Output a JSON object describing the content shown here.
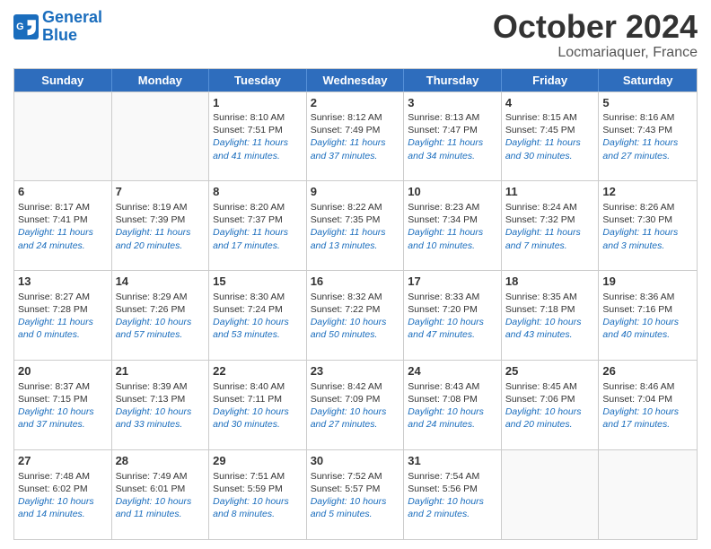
{
  "logo": {
    "text_general": "General",
    "text_blue": "Blue"
  },
  "title": "October 2024",
  "subtitle": "Locmariaquer, France",
  "weekdays": [
    "Sunday",
    "Monday",
    "Tuesday",
    "Wednesday",
    "Thursday",
    "Friday",
    "Saturday"
  ],
  "weeks": [
    [
      {
        "day": "",
        "sunrise": "",
        "sunset": "",
        "daylight": ""
      },
      {
        "day": "",
        "sunrise": "",
        "sunset": "",
        "daylight": ""
      },
      {
        "day": "1",
        "sunrise": "Sunrise: 8:10 AM",
        "sunset": "Sunset: 7:51 PM",
        "daylight": "Daylight: 11 hours and 41 minutes."
      },
      {
        "day": "2",
        "sunrise": "Sunrise: 8:12 AM",
        "sunset": "Sunset: 7:49 PM",
        "daylight": "Daylight: 11 hours and 37 minutes."
      },
      {
        "day": "3",
        "sunrise": "Sunrise: 8:13 AM",
        "sunset": "Sunset: 7:47 PM",
        "daylight": "Daylight: 11 hours and 34 minutes."
      },
      {
        "day": "4",
        "sunrise": "Sunrise: 8:15 AM",
        "sunset": "Sunset: 7:45 PM",
        "daylight": "Daylight: 11 hours and 30 minutes."
      },
      {
        "day": "5",
        "sunrise": "Sunrise: 8:16 AM",
        "sunset": "Sunset: 7:43 PM",
        "daylight": "Daylight: 11 hours and 27 minutes."
      }
    ],
    [
      {
        "day": "6",
        "sunrise": "Sunrise: 8:17 AM",
        "sunset": "Sunset: 7:41 PM",
        "daylight": "Daylight: 11 hours and 24 minutes."
      },
      {
        "day": "7",
        "sunrise": "Sunrise: 8:19 AM",
        "sunset": "Sunset: 7:39 PM",
        "daylight": "Daylight: 11 hours and 20 minutes."
      },
      {
        "day": "8",
        "sunrise": "Sunrise: 8:20 AM",
        "sunset": "Sunset: 7:37 PM",
        "daylight": "Daylight: 11 hours and 17 minutes."
      },
      {
        "day": "9",
        "sunrise": "Sunrise: 8:22 AM",
        "sunset": "Sunset: 7:35 PM",
        "daylight": "Daylight: 11 hours and 13 minutes."
      },
      {
        "day": "10",
        "sunrise": "Sunrise: 8:23 AM",
        "sunset": "Sunset: 7:34 PM",
        "daylight": "Daylight: 11 hours and 10 minutes."
      },
      {
        "day": "11",
        "sunrise": "Sunrise: 8:24 AM",
        "sunset": "Sunset: 7:32 PM",
        "daylight": "Daylight: 11 hours and 7 minutes."
      },
      {
        "day": "12",
        "sunrise": "Sunrise: 8:26 AM",
        "sunset": "Sunset: 7:30 PM",
        "daylight": "Daylight: 11 hours and 3 minutes."
      }
    ],
    [
      {
        "day": "13",
        "sunrise": "Sunrise: 8:27 AM",
        "sunset": "Sunset: 7:28 PM",
        "daylight": "Daylight: 11 hours and 0 minutes."
      },
      {
        "day": "14",
        "sunrise": "Sunrise: 8:29 AM",
        "sunset": "Sunset: 7:26 PM",
        "daylight": "Daylight: 10 hours and 57 minutes."
      },
      {
        "day": "15",
        "sunrise": "Sunrise: 8:30 AM",
        "sunset": "Sunset: 7:24 PM",
        "daylight": "Daylight: 10 hours and 53 minutes."
      },
      {
        "day": "16",
        "sunrise": "Sunrise: 8:32 AM",
        "sunset": "Sunset: 7:22 PM",
        "daylight": "Daylight: 10 hours and 50 minutes."
      },
      {
        "day": "17",
        "sunrise": "Sunrise: 8:33 AM",
        "sunset": "Sunset: 7:20 PM",
        "daylight": "Daylight: 10 hours and 47 minutes."
      },
      {
        "day": "18",
        "sunrise": "Sunrise: 8:35 AM",
        "sunset": "Sunset: 7:18 PM",
        "daylight": "Daylight: 10 hours and 43 minutes."
      },
      {
        "day": "19",
        "sunrise": "Sunrise: 8:36 AM",
        "sunset": "Sunset: 7:16 PM",
        "daylight": "Daylight: 10 hours and 40 minutes."
      }
    ],
    [
      {
        "day": "20",
        "sunrise": "Sunrise: 8:37 AM",
        "sunset": "Sunset: 7:15 PM",
        "daylight": "Daylight: 10 hours and 37 minutes."
      },
      {
        "day": "21",
        "sunrise": "Sunrise: 8:39 AM",
        "sunset": "Sunset: 7:13 PM",
        "daylight": "Daylight: 10 hours and 33 minutes."
      },
      {
        "day": "22",
        "sunrise": "Sunrise: 8:40 AM",
        "sunset": "Sunset: 7:11 PM",
        "daylight": "Daylight: 10 hours and 30 minutes."
      },
      {
        "day": "23",
        "sunrise": "Sunrise: 8:42 AM",
        "sunset": "Sunset: 7:09 PM",
        "daylight": "Daylight: 10 hours and 27 minutes."
      },
      {
        "day": "24",
        "sunrise": "Sunrise: 8:43 AM",
        "sunset": "Sunset: 7:08 PM",
        "daylight": "Daylight: 10 hours and 24 minutes."
      },
      {
        "day": "25",
        "sunrise": "Sunrise: 8:45 AM",
        "sunset": "Sunset: 7:06 PM",
        "daylight": "Daylight: 10 hours and 20 minutes."
      },
      {
        "day": "26",
        "sunrise": "Sunrise: 8:46 AM",
        "sunset": "Sunset: 7:04 PM",
        "daylight": "Daylight: 10 hours and 17 minutes."
      }
    ],
    [
      {
        "day": "27",
        "sunrise": "Sunrise: 7:48 AM",
        "sunset": "Sunset: 6:02 PM",
        "daylight": "Daylight: 10 hours and 14 minutes."
      },
      {
        "day": "28",
        "sunrise": "Sunrise: 7:49 AM",
        "sunset": "Sunset: 6:01 PM",
        "daylight": "Daylight: 10 hours and 11 minutes."
      },
      {
        "day": "29",
        "sunrise": "Sunrise: 7:51 AM",
        "sunset": "Sunset: 5:59 PM",
        "daylight": "Daylight: 10 hours and 8 minutes."
      },
      {
        "day": "30",
        "sunrise": "Sunrise: 7:52 AM",
        "sunset": "Sunset: 5:57 PM",
        "daylight": "Daylight: 10 hours and 5 minutes."
      },
      {
        "day": "31",
        "sunrise": "Sunrise: 7:54 AM",
        "sunset": "Sunset: 5:56 PM",
        "daylight": "Daylight: 10 hours and 2 minutes."
      },
      {
        "day": "",
        "sunrise": "",
        "sunset": "",
        "daylight": ""
      },
      {
        "day": "",
        "sunrise": "",
        "sunset": "",
        "daylight": ""
      }
    ]
  ]
}
